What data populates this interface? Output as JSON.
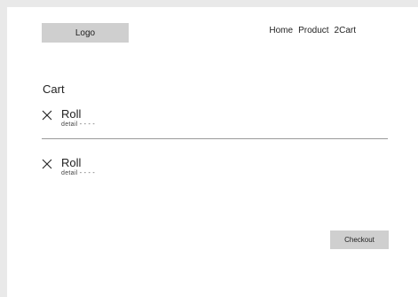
{
  "header": {
    "logo_text": "Logo",
    "nav": [
      {
        "label": "Home"
      },
      {
        "label": "Product"
      },
      {
        "label": "2Cart"
      }
    ]
  },
  "cart": {
    "title": "Cart",
    "items": [
      {
        "name": "Roll",
        "detail": "detail - - - -",
        "remove_icon": "close-icon"
      },
      {
        "name": "Roll",
        "detail": "detail - - - -",
        "remove_icon": "close-icon"
      }
    ],
    "checkout_label": "Checkout"
  }
}
